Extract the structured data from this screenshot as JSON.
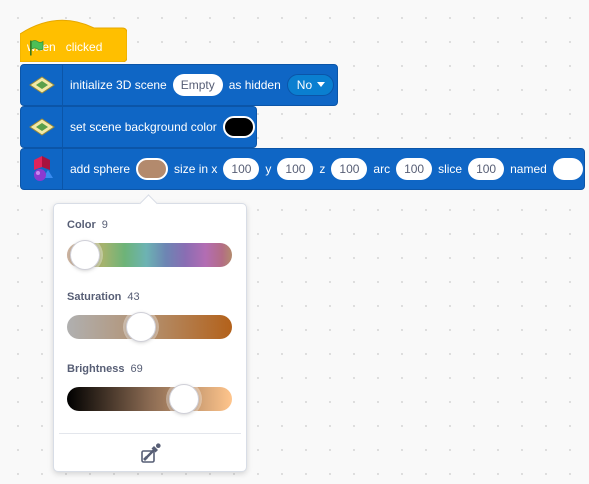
{
  "hat_block": {
    "when_label": "when",
    "clicked_label": "clicked",
    "flag_icon": "green-flag-icon",
    "color": "#ffbf00"
  },
  "init_block": {
    "label": "initialize 3D scene",
    "scene_value": "Empty",
    "hidden_label": "as hidden",
    "hidden_value": "No",
    "icon": "3d-extension-icon"
  },
  "background_block": {
    "label": "set scene background color",
    "color_value": "#000000",
    "icon": "3d-extension-icon"
  },
  "sphere_block": {
    "label": "add sphere",
    "color_value": "#b38a6d",
    "size_label": "size in x",
    "x_value": "100",
    "y_label": "y",
    "y_value": "100",
    "z_label": "z",
    "z_value": "100",
    "arc_label": "arc",
    "arc_value": "100",
    "slice_label": "slice",
    "slice_value": "100",
    "named_label": "named",
    "named_value": "",
    "icon": "3d-shapes-icon",
    "block_color": "#0f66c5"
  },
  "color_picker": {
    "color": {
      "label": "Color",
      "value": "9",
      "level": 0.09
    },
    "saturation": {
      "label": "Saturation",
      "value": "43",
      "level": 0.43
    },
    "brightness": {
      "label": "Brightness",
      "value": "69",
      "level": 0.69
    },
    "eyedropper_icon": "eyedropper-icon"
  }
}
